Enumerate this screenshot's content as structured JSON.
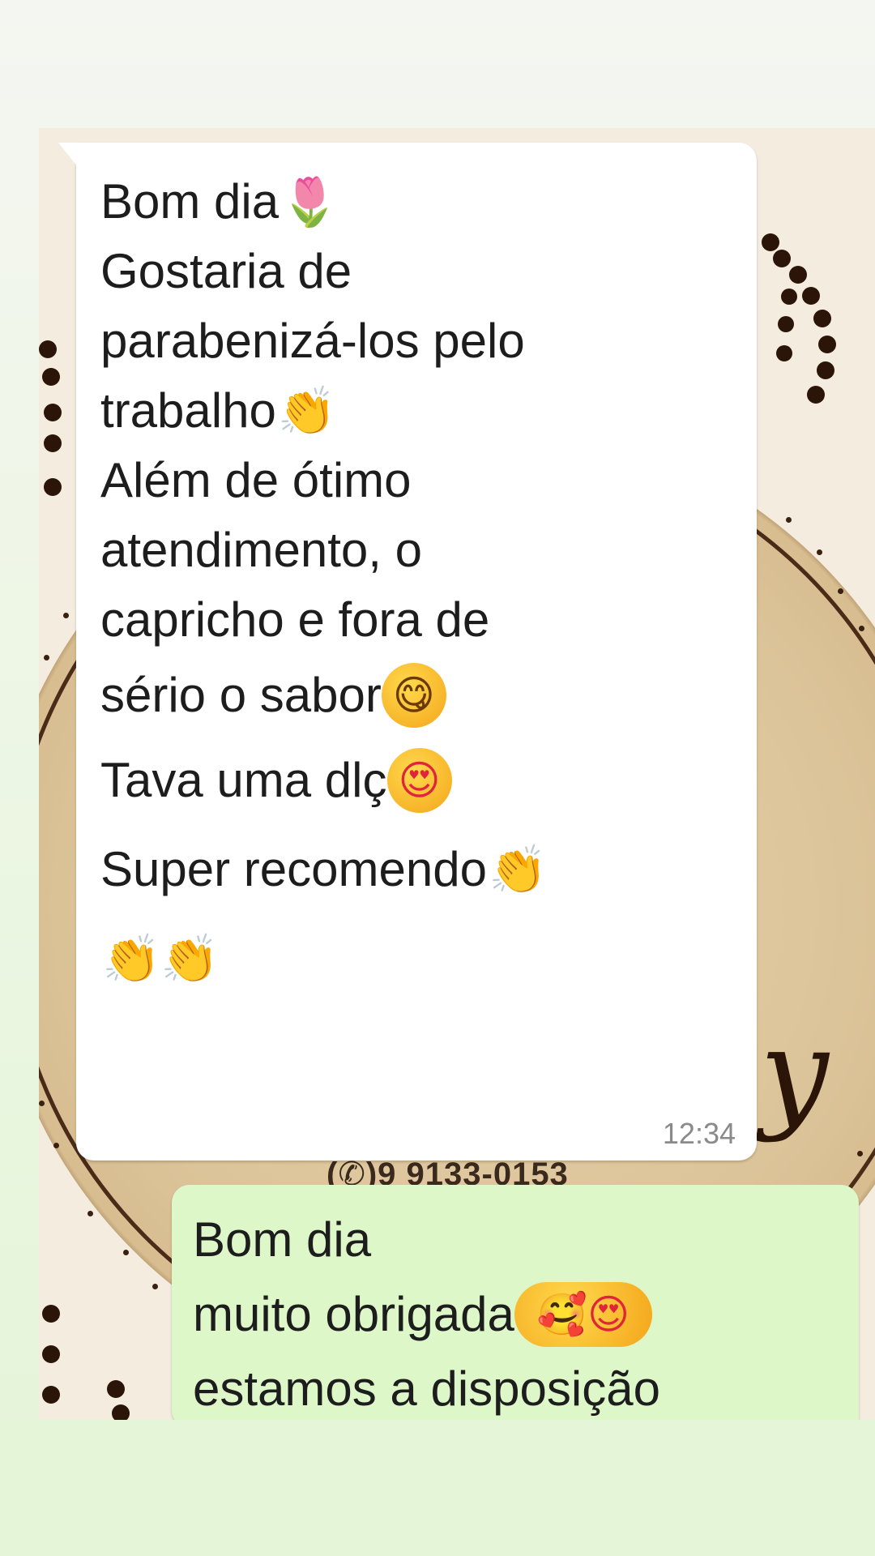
{
  "incoming_message": {
    "lines": [
      {
        "text": "Bom dia",
        "emoji": "🌷"
      },
      {
        "text": "Gostaria de",
        "emoji": ""
      },
      {
        "text": "parabenizá-los pelo",
        "emoji": ""
      },
      {
        "text": "trabalho",
        "emoji": "👏"
      },
      {
        "text": "Além de ótimo",
        "emoji": ""
      },
      {
        "text": "atendimento, o",
        "emoji": ""
      },
      {
        "text": "capricho e fora de",
        "emoji": ""
      },
      {
        "text": "sério o sabor",
        "emoji": "😋"
      },
      {
        "text": "Tava uma dlç",
        "emoji": "😍"
      },
      {
        "text": "Super recomendo",
        "emoji": "👏"
      },
      {
        "text": "",
        "emoji": "👏👏"
      }
    ],
    "time": "12:34"
  },
  "outgoing_message": {
    "lines": [
      {
        "text": "Bom dia",
        "emoji": ""
      },
      {
        "text": "muito obrigada",
        "emoji": "🥰😍"
      },
      {
        "text": "estamos a disposição",
        "emoji": ""
      }
    ]
  },
  "wallpaper": {
    "phone_text": "(✆)9 9133-0153",
    "script_letter": "y"
  },
  "colors": {
    "incoming_bubble": "#ffffff",
    "outgoing_bubble": "#ddf7c8",
    "wallpaper_disc": "#dcc49a",
    "dots": "#2b1508"
  },
  "icons": {
    "flower": "tulip-emoji",
    "clap": "clapping-hands-emoji",
    "yum": "face-savoring-food-emoji",
    "love": "heart-eyes-emoji",
    "hearts": "smiling-face-with-hearts-emoji"
  }
}
